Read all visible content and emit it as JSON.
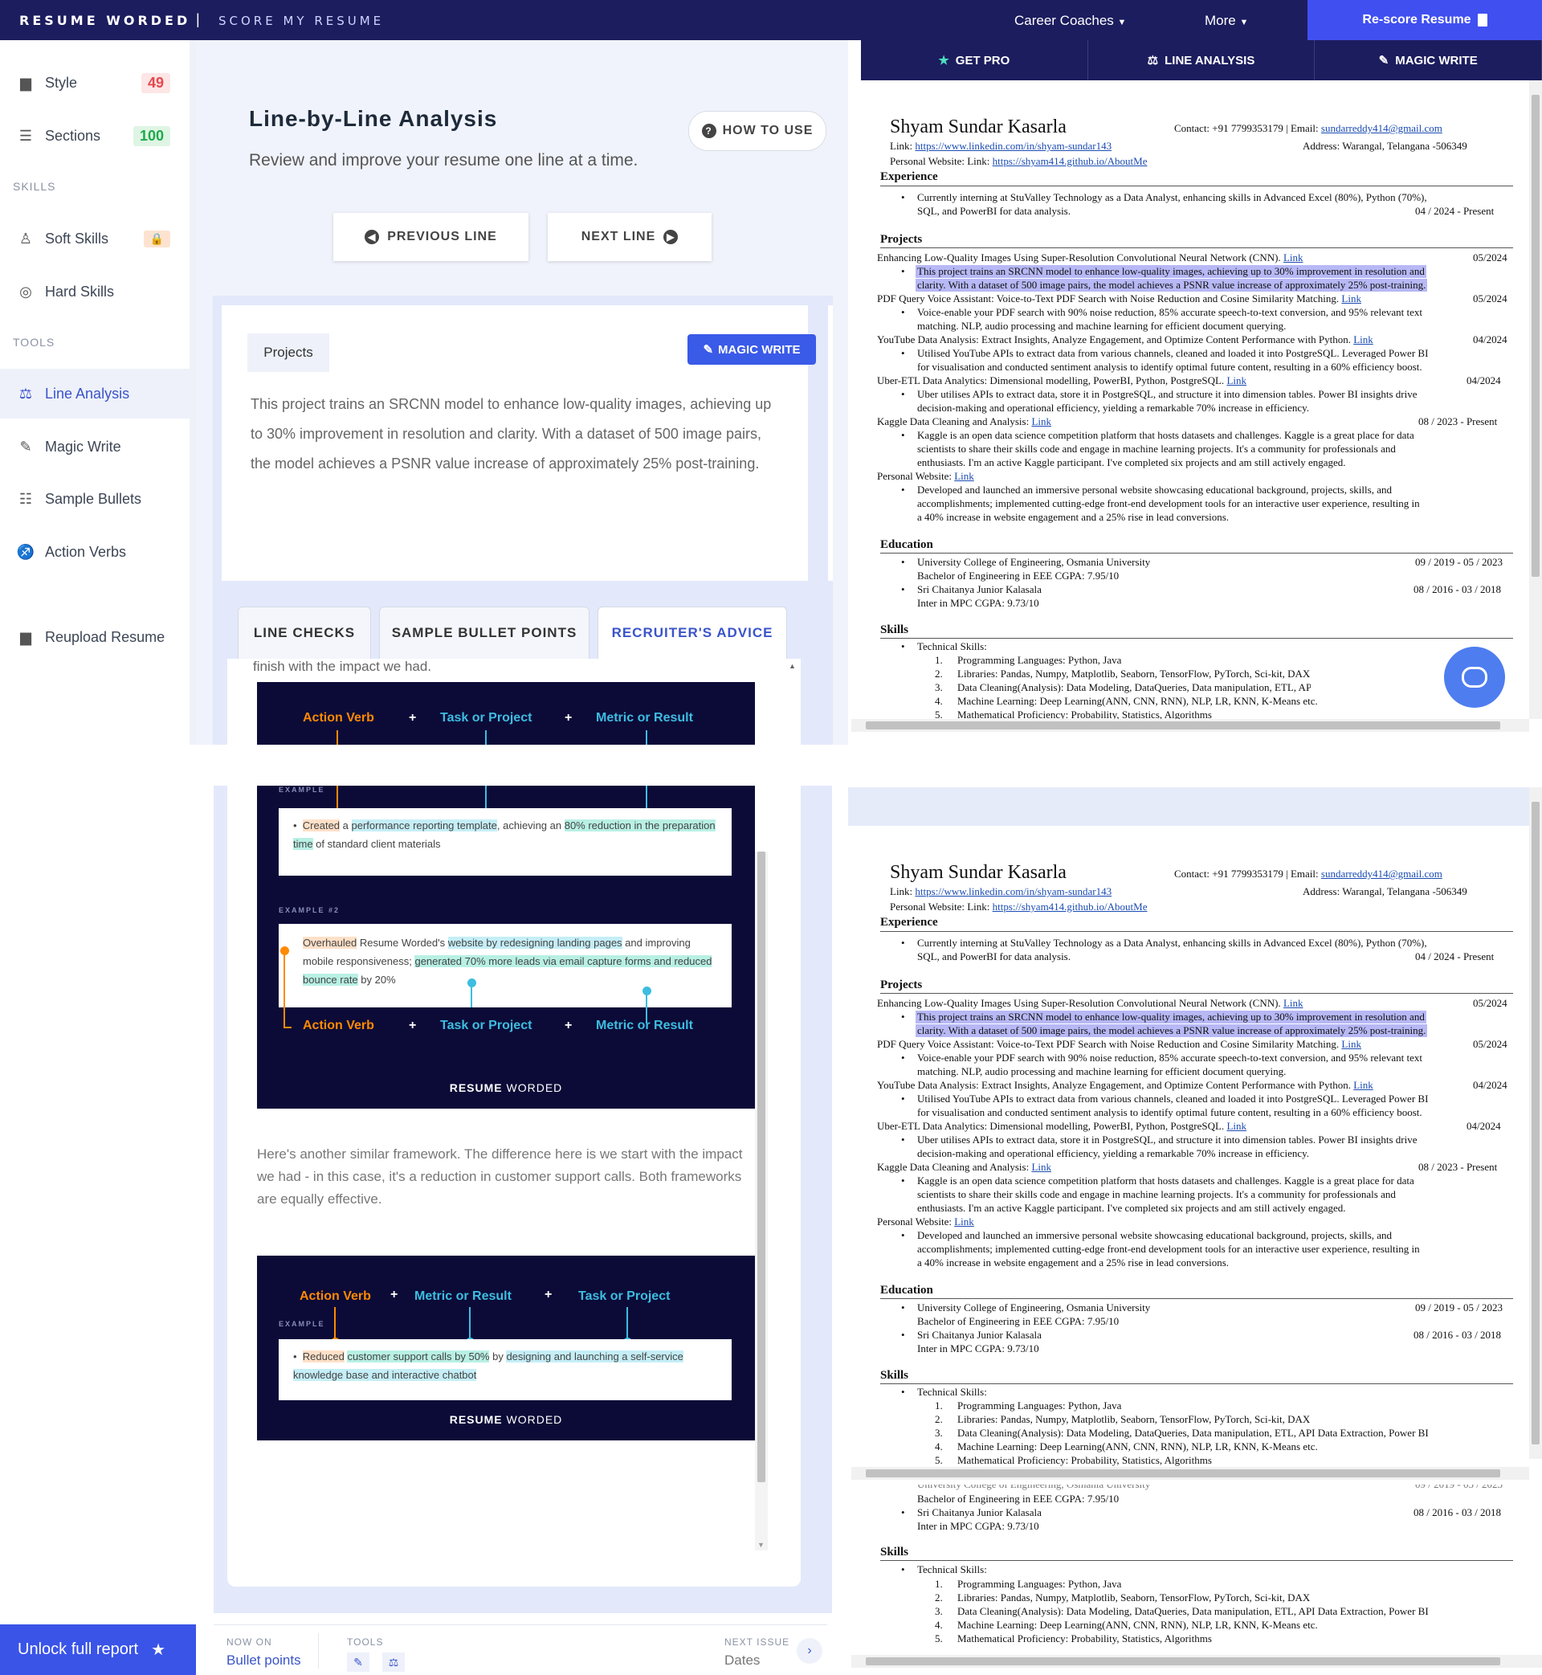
{
  "topbar": {
    "brand": "RESUME WORDED",
    "separator": "|",
    "product": "SCORE MY RESUME",
    "nav": [
      {
        "label": "Career Coaches"
      },
      {
        "label": "More"
      }
    ],
    "rescore_label": "Re-score Resume"
  },
  "sidebar": {
    "items": [
      {
        "label": "Style",
        "score": "49",
        "icon": "document-icon"
      },
      {
        "label": "Sections",
        "score": "100",
        "icon": "list-icon"
      }
    ],
    "skills_heading": "SKILLS",
    "skills": [
      {
        "label": "Soft Skills",
        "icon": "person-icon",
        "locked": true
      },
      {
        "label": "Hard Skills",
        "icon": "target-icon"
      }
    ],
    "tools_heading": "TOOLS",
    "tools": [
      {
        "label": "Line Analysis",
        "icon": "line-analysis-icon",
        "active": true
      },
      {
        "label": "Magic Write",
        "icon": "magic-wand-icon"
      },
      {
        "label": "Sample Bullets",
        "icon": "bullets-icon"
      },
      {
        "label": "Action Verbs",
        "icon": "verbs-icon"
      }
    ],
    "reupload": "Reupload Resume",
    "score_colors": {
      "bad": "#e5484d",
      "good": "#1ea94b"
    }
  },
  "main": {
    "title": "Line-by-Line Analysis",
    "subtitle": "Review and improve your resume one line at a time.",
    "how_to_use": "HOW TO USE",
    "previous_line": "PREVIOUS LINE",
    "next_line": "NEXT LINE",
    "section_tag": "Projects",
    "magic_write": "MAGIC WRITE",
    "line_text": "This project trains an SRCNN model to enhance low-quality images, achieving up to 30% improvement in resolution and clarity. With a dataset of 500 image pairs, the model achieves a PSNR value increase of approximately 25% post-training.",
    "tabs": [
      {
        "label": "LINE CHECKS"
      },
      {
        "label": "SAMPLE BULLET POINTS"
      },
      {
        "label": "RECRUITER'S ADVICE",
        "active": true
      }
    ],
    "advice_top_text": "finish with the impact we had.",
    "framework1": {
      "a": "Action Verb",
      "plus": "+",
      "b": "Task or Project",
      "c": "Metric or Result"
    },
    "example_label": "EXAMPLE",
    "example2_label": "EXAMPLE #2",
    "example1": {
      "p1": "Created",
      "p2": " a ",
      "p3": "performance reporting template",
      "p4": ", achieving an ",
      "p5": "80% reduction in the preparation time",
      "p6": " of standard client materials"
    },
    "example2": {
      "p1": "Overhauled",
      "p2": " Resume Worded's ",
      "p3": "website by redesigning landing pages",
      "p4": " and improving mobile responsiveness; ",
      "p5": "generated 70% more leads via email capture forms and reduced bounce rate",
      "p6": " by 20%"
    },
    "brand_bold": "RESUME",
    "brand_light": "WORDED",
    "paragraph": "Here's another similar framework. The difference here is we start with the impact we had - in this case, it's a reduction in customer support calls. Both frameworks are equally effective.",
    "framework2": {
      "a": "Action Verb",
      "plus": "+",
      "b": "Metric or Result",
      "c": "Task or Project"
    },
    "example3": {
      "p1": "Reduced",
      "p2": " ",
      "p3": "customer support calls by 50%",
      "p4": " by ",
      "p5": "designing and launching a self-service knowledge base and interactive chatbot"
    }
  },
  "preview_tabs": [
    {
      "label": "GET PRO",
      "icon": "star-icon"
    },
    {
      "label": "LINE ANALYSIS",
      "icon": "line-analysis-icon"
    },
    {
      "label": "MAGIC WRITE",
      "icon": "magic-wand-icon"
    }
  ],
  "resume": {
    "name": "Shyam Sundar Kasarla",
    "contact_label": "Contact: +91 7799353179 | Email: ",
    "email": "sundarreddy414@gmail.com",
    "link_label": "Link: ",
    "linkedin": "https://www.linkedin.com/in/shyam-sundar143",
    "address": "Address: Warangal, Telangana -506349",
    "website_label": "Personal Website: Link: ",
    "website": "https://shyam414.github.io/AboutMe",
    "experience_heading": "Experience",
    "exp1": "Currently interning at StuValley Technology as a Data Analyst, enhancing skills in Advanced Excel (80%), Python (70%),",
    "exp2": "SQL, and PowerBI for data analysis.",
    "exp_date": "04 / 2024 - Present",
    "projects_heading": "Projects",
    "link_word": "Link",
    "p1_title": "Enhancing Low-Quality Images Using Super-Resolution Convolutional Neural Network (CNN).",
    "p1_date": "05/2024",
    "p1_b1": "This project trains an SRCNN model to enhance low-quality images, achieving up to 30% improvement in resolution and",
    "p1_b2": "clarity. With a dataset of 500 image pairs, the model achieves a PSNR value increase of approximately 25% post-training.",
    "p2_title": "PDF Query Voice Assistant: Voice-to-Text PDF Search with Noise Reduction and Cosine Similarity Matching.",
    "p2_date": "05/2024",
    "p2_b1": "Voice-enable your PDF search with 90% noise reduction, 85% accurate speech-to-text conversion, and 95% relevant text",
    "p2_b2": "matching. NLP, audio processing and machine learning for efficient document querying.",
    "p3_title": "YouTube Data Analysis: Extract Insights, Analyze Engagement, and Optimize Content Performance with Python.",
    "p3_date": "04/2024",
    "p3_b1": "Utilised YouTube APIs to extract data from various channels, cleaned and loaded it into PostgreSQL. Leveraged Power BI",
    "p3_b2": "for visualisation and conducted sentiment analysis to identify optimal future content, resulting in a 60% efficiency boost.",
    "p4_title": "Uber-ETL Data Analytics: Dimensional modelling, PowerBI, Python, PostgreSQL.",
    "p4_date": "04/2024",
    "p4_b1": "Uber utilises APIs to extract data, store it in PostgreSQL, and structure it into dimension tables. Power BI insights drive",
    "p4_b2": "decision-making and operational efficiency, yielding a remarkable 70% increase in efficiency.",
    "p5_title": "Kaggle Data Cleaning and Analysis:",
    "p5_date": "08 / 2023 - Present",
    "p5_b1": "Kaggle is an open data science competition platform that hosts datasets and challenges. Kaggle is a great place for data",
    "p5_b2": "scientists to share their skills code and engage in machine learning projects. It's a community for professionals and",
    "p5_b3": "enthusiasts. I'm an active Kaggle participant. I've completed six projects and am still actively engaged.",
    "p6_title": "Personal Website:",
    "p6_b1": "Developed and launched an immersive personal website showcasing educational background, projects, skills, and",
    "p6_b2": "accomplishments; implemented cutting-edge front-end development tools for an interactive user experience, resulting in",
    "p6_b3": "a 40% increase in website engagement and a 25% rise in lead conversions.",
    "education_heading": "Education",
    "e1": "University College of Engineering, Osmania University",
    "e1_date": "09 / 2019 - 05 / 2023",
    "e1_sub": "Bachelor of Engineering in EEE CGPA: 7.95/10",
    "e2": "Sri Chaitanya Junior Kalasala",
    "e2_date": "08 / 2016 - 03 / 2018",
    "e2_sub": "Inter in MPC  CGPA: 9.73/10",
    "skills_heading": "Skills",
    "s0": "Technical Skills:",
    "s1": "Programming Languages: Python, Java",
    "s2": "Libraries: Pandas, Numpy, Matplotlib, Seaborn, TensorFlow, PyTorch, Sci-kit, DAX",
    "s3": "Data Cleaning(Analysis): Data Modeling, DataQueries, Data manipulation, ETL, API Data Extraction, Power BI",
    "s4": "Machine Learning: Deep Learning(ANN, CNN, RNN), NLP, LR, KNN, K-Means etc.",
    "s5": "Mathematical Proficiency: Probability, Statistics, Algorithms",
    "e1_cut": "University College of Engineering, Osmania University",
    "e1_date_cut": "09 / 2019 - 05 / 2023",
    "n1": "1.",
    "n2": "2.",
    "n3": "3.",
    "n4": "4.",
    "n5": "5."
  },
  "bottom": {
    "unlock": "Unlock full report",
    "now_on_label": "NOW ON",
    "now_on_value": "Bullet points",
    "tools_label": "TOOLS",
    "next_issue_label": "NEXT ISSUE",
    "next_issue_value": "Dates"
  },
  "colors": {
    "navy": "#1c1d5e",
    "accent": "#4050f0",
    "orange": "#ff8a00",
    "cyan": "#3dbde0",
    "highlight": "#b7b8f5"
  }
}
